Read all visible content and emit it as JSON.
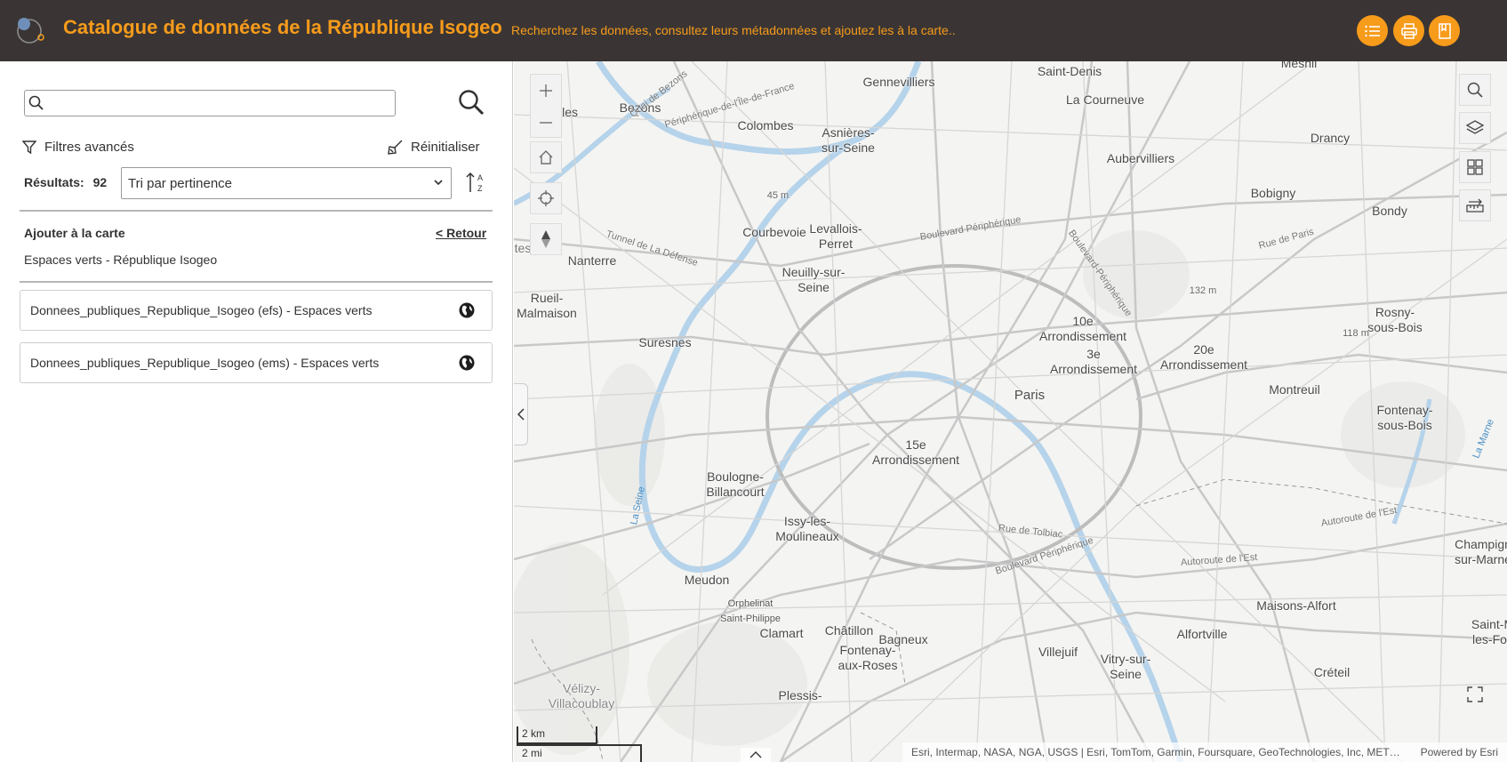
{
  "header": {
    "title": "Catalogue de données de la République Isogeo",
    "subtitle": "Recherchez les données, consultez leurs métadonnées et ajoutez les à la carte..",
    "accent_color": "#f79b1b",
    "background_color": "#3a3534",
    "buttons": [
      {
        "icon": "list-icon"
      },
      {
        "icon": "print-icon"
      },
      {
        "icon": "bookmark-icon"
      }
    ]
  },
  "search": {
    "value": "",
    "placeholder": ""
  },
  "filters": {
    "advanced_label": "Filtres avancés",
    "reset_label": "Réinitialiser"
  },
  "results": {
    "label": "Résultats:",
    "count": "92",
    "sort_selected": "Tri par pertinence"
  },
  "add_to_map": {
    "title": "Ajouter à la carte",
    "back_label": "< Retour",
    "group_name": "Espaces verts - République Isogeo",
    "services": [
      {
        "label": "Donnees_publiques_Republique_Isogeo (efs) - Espaces verts",
        "icon": "globe-icon"
      },
      {
        "label": "Donnees_publiques_Republique_Isogeo (ems) - Espaces verts",
        "icon": "globe-icon"
      }
    ]
  },
  "map": {
    "places": [
      {
        "name": "Saint-Denis"
      },
      {
        "name": "Mesnil"
      },
      {
        "name": "Gennevilliers"
      },
      {
        "name": "La Courneuve"
      },
      {
        "name": "Bezons"
      },
      {
        "name": "illes"
      },
      {
        "name": "Colombes"
      },
      {
        "name": "Asnières-\nsur-Seine"
      },
      {
        "name": "Drancy"
      },
      {
        "name": "Aubervilliers"
      },
      {
        "name": "Bobigny"
      },
      {
        "name": "Bondy"
      },
      {
        "name": "Courbevoie"
      },
      {
        "name": "Levallois-\nPerret"
      },
      {
        "name": "Nanterre"
      },
      {
        "name": "Neuilly-sur-\nSeine"
      },
      {
        "name": "Rueil-\nMalmaison"
      },
      {
        "name": "Suresnes"
      },
      {
        "name": "10e\nArrondissement"
      },
      {
        "name": "3e\nArrondissement"
      },
      {
        "name": "20e\nArrondissement"
      },
      {
        "name": "Rosny-\nsous-Bois"
      },
      {
        "name": "Paris"
      },
      {
        "name": "Montreuil"
      },
      {
        "name": "Fontenay-\nsous-Bois"
      },
      {
        "name": "15e\nArrondissement"
      },
      {
        "name": "Boulogne-\nBillancourt"
      },
      {
        "name": "Issy-les-\nMoulineaux"
      },
      {
        "name": "Champign\nsur-Marne"
      },
      {
        "name": "Meudon"
      },
      {
        "name": "Maisons-Alfort"
      },
      {
        "name": "Clamart"
      },
      {
        "name": "Châtillon"
      },
      {
        "name": "Alfortville"
      },
      {
        "name": "Bagneux"
      },
      {
        "name": "Fontenay-\naux-Roses"
      },
      {
        "name": "Villejuif"
      },
      {
        "name": "Vitry-sur-\nSeine"
      },
      {
        "name": "Créteil"
      },
      {
        "name": "Plessis-"
      },
      {
        "name": "Vélizy-\nVillacoublay"
      },
      {
        "name": "Saint-M\nles-Fos"
      },
      {
        "name": "tes"
      }
    ],
    "small_labels": [
      {
        "name": "45 m"
      },
      {
        "name": "132 m"
      },
      {
        "name": "118 m"
      },
      {
        "name": "Orphelinat\nSaint-Philippe"
      }
    ],
    "road_labels": [
      {
        "name": "Quai de Bezons"
      },
      {
        "name": "Périphérique-de-l'Île-de-France"
      },
      {
        "name": "Tunnel de La Défense"
      },
      {
        "name": "Boulevard Périphérique"
      },
      {
        "name": "Boulevard-Périphérique"
      },
      {
        "name": "Rue de Paris"
      },
      {
        "name": "Rue de Tolbiac"
      },
      {
        "name": "Boulevard Périphérique"
      },
      {
        "name": "Autoroute de l'Est"
      },
      {
        "name": "Autoroute de l'Est"
      }
    ],
    "water_labels": [
      {
        "name": "La Seine"
      },
      {
        "name": "La Marne"
      }
    ],
    "scale": {
      "km": "2 km",
      "mi": "2 mi"
    },
    "attribution": "Esri, Intermap, NASA, NGA, USGS | Esri, TomTom, Garmin, Foursquare, GeoTechnologies, Inc, METI/NASA, USGS",
    "powered_by": "Powered by Esri"
  }
}
